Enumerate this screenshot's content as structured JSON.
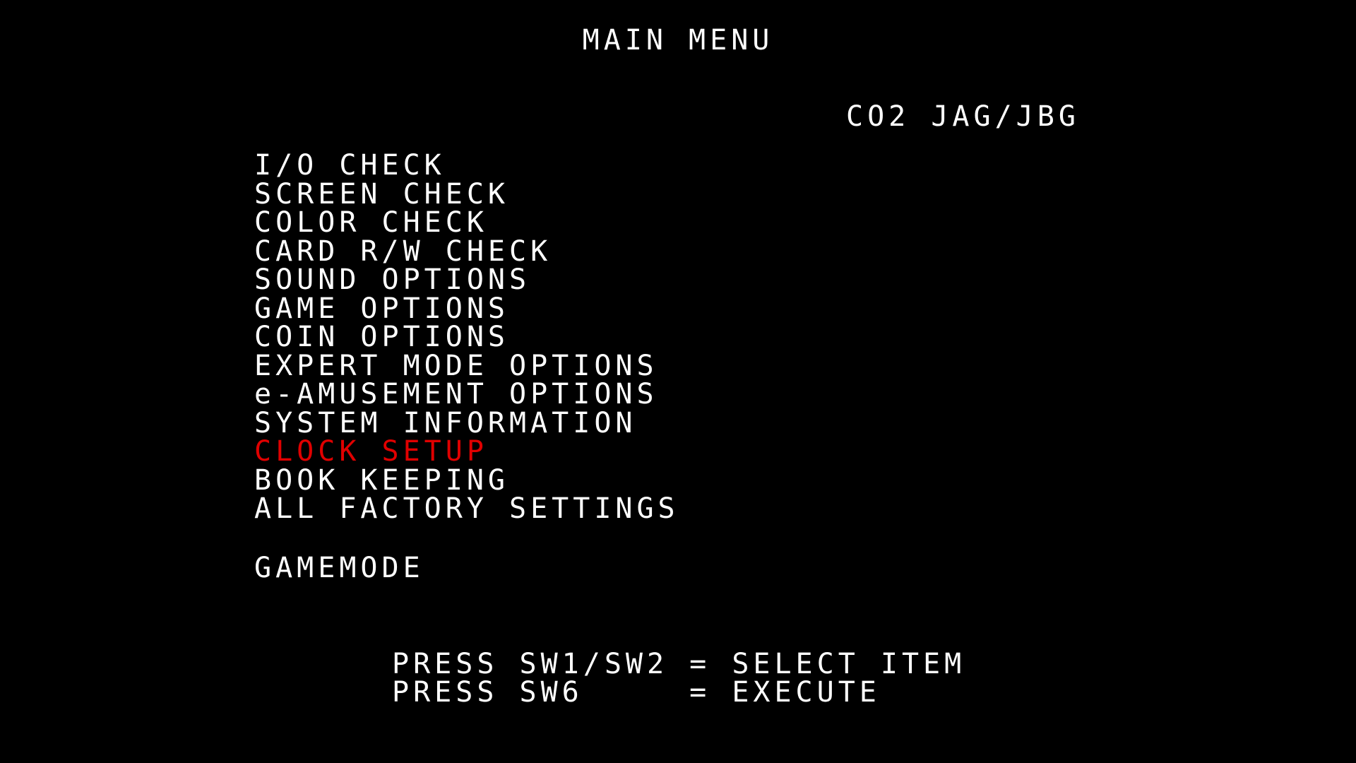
{
  "screen": {
    "title": "MAIN MENU",
    "version": "CO2 JAG/JBG"
  },
  "menu": {
    "items": [
      {
        "label": "I/O CHECK",
        "selected": false
      },
      {
        "label": "SCREEN CHECK",
        "selected": false
      },
      {
        "label": "COLOR CHECK",
        "selected": false
      },
      {
        "label": "CARD R/W CHECK",
        "selected": false
      },
      {
        "label": "SOUND OPTIONS",
        "selected": false
      },
      {
        "label": "GAME OPTIONS",
        "selected": false
      },
      {
        "label": "COIN OPTIONS",
        "selected": false
      },
      {
        "label": "EXPERT MODE OPTIONS",
        "selected": false
      },
      {
        "label": "e-AMUSEMENT OPTIONS",
        "selected": false
      },
      {
        "label": "SYSTEM INFORMATION",
        "selected": false
      },
      {
        "label": "CLOCK SETUP",
        "selected": true
      },
      {
        "label": "BOOK KEEPING",
        "selected": false
      },
      {
        "label": "ALL FACTORY SETTINGS",
        "selected": false
      }
    ],
    "gamemode_label": "GAMEMODE"
  },
  "instructions": {
    "select_line": "PRESS SW1/SW2 = SELECT ITEM",
    "execute_line": "PRESS SW6     = EXECUTE"
  },
  "colors": {
    "background": "#000000",
    "text": "#ffffff",
    "selected": "#e00000"
  }
}
